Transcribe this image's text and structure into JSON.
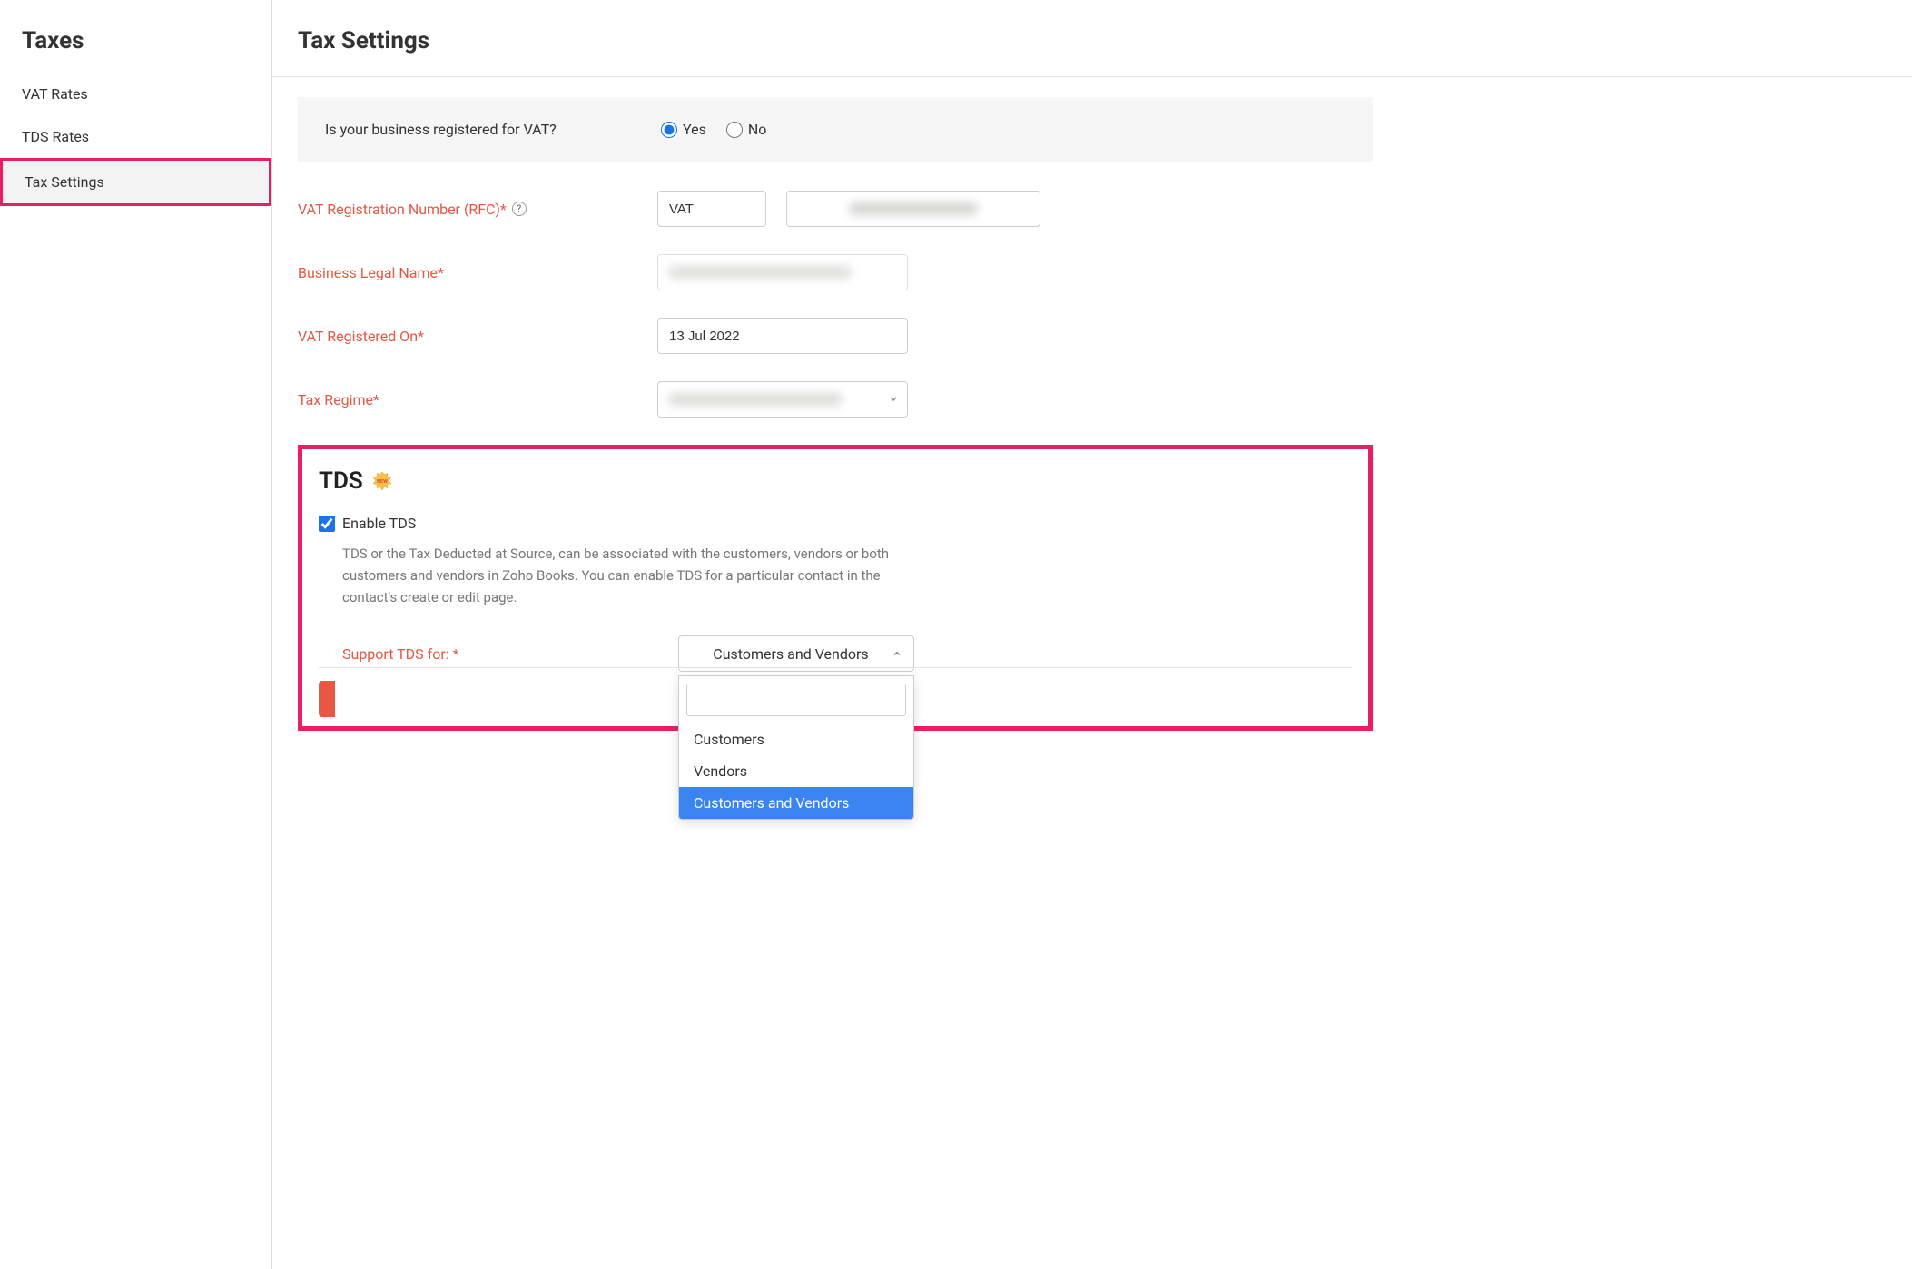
{
  "sidebar": {
    "header": "Taxes",
    "items": [
      {
        "label": "VAT Rates",
        "active": false
      },
      {
        "label": "TDS Rates",
        "active": false
      },
      {
        "label": "Tax Settings",
        "active": true
      }
    ]
  },
  "page": {
    "title": "Tax Settings"
  },
  "vat_question": {
    "label": "Is your business registered for VAT?",
    "options": {
      "yes": "Yes",
      "no": "No"
    },
    "selected": "yes"
  },
  "fields": {
    "vat_reg_number": {
      "label": "VAT Registration Number (RFC)*",
      "prefix_value": "VAT",
      "number_value": ""
    },
    "business_legal_name": {
      "label": "Business Legal Name*",
      "value": ""
    },
    "vat_registered_on": {
      "label": "VAT Registered On*",
      "value": "13 Jul 2022"
    },
    "tax_regime": {
      "label": "Tax Regime*",
      "value": ""
    }
  },
  "tds": {
    "title": "TDS",
    "badge": "NEW",
    "enable_label": "Enable TDS",
    "enabled": true,
    "description": "TDS or the Tax Deducted at Source, can be associated with the customers, vendors or both customers and vendors in Zoho Books. You can enable TDS for a particular contact in the contact's create or edit page.",
    "support_label": "Support TDS for: *",
    "selected": "Customers and Vendors",
    "dropdown": {
      "search_value": "",
      "options": [
        "Customers",
        "Vendors",
        "Customers and Vendors"
      ],
      "highlighted": "Customers and Vendors"
    }
  }
}
